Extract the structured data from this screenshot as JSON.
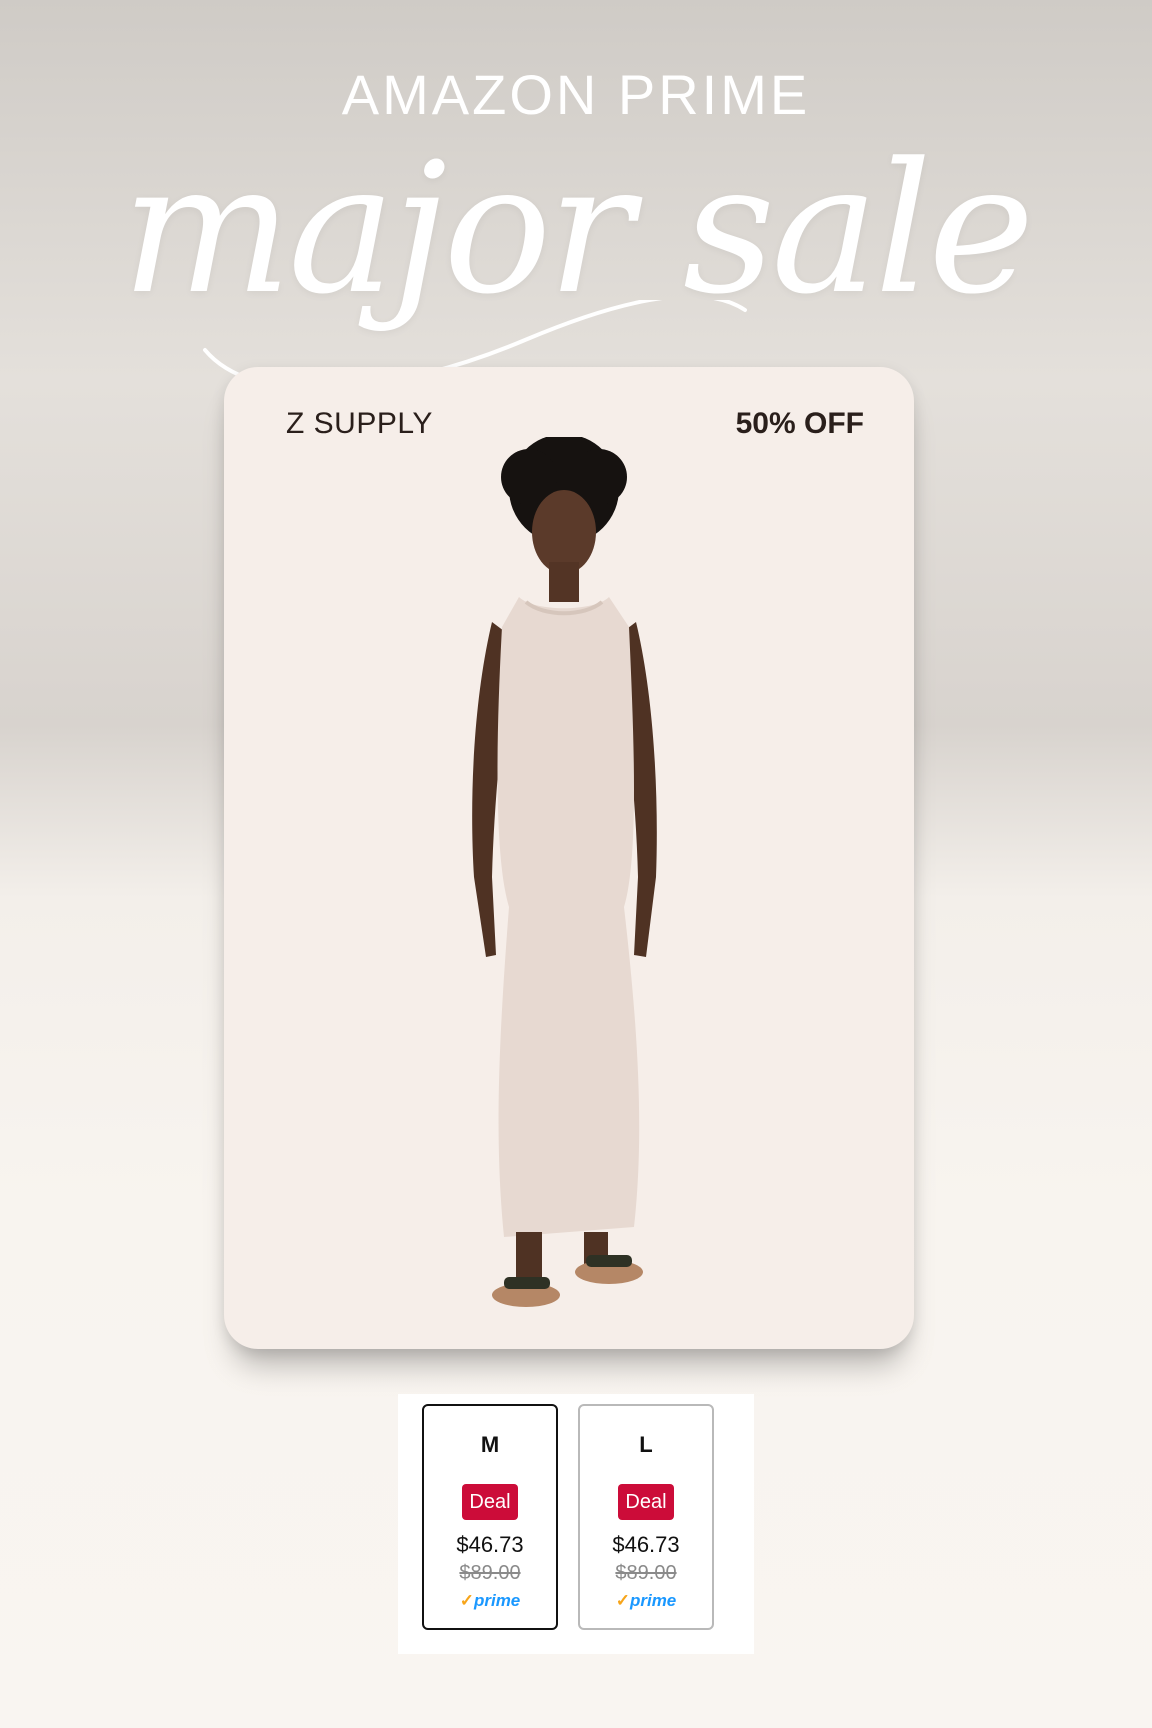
{
  "header": {
    "kicker": "AMAZON PRIME",
    "script_title": "major sale"
  },
  "product": {
    "brand": "Z SUPPLY",
    "discount": "50% OFF"
  },
  "sizes": [
    {
      "name": "M",
      "badge": "Deal",
      "price": "$46.73",
      "list_price": "$89.00",
      "prime": "prime",
      "selected": true
    },
    {
      "name": "L",
      "badge": "Deal",
      "price": "$46.73",
      "list_price": "$89.00",
      "prime": "prime",
      "selected": false
    }
  ],
  "colors": {
    "deal_red": "#cc0c39",
    "prime_blue": "#1a98ff",
    "prime_check": "#f7a51a",
    "card_bg": "#f6eee9",
    "dress": "#e7d9d1"
  }
}
